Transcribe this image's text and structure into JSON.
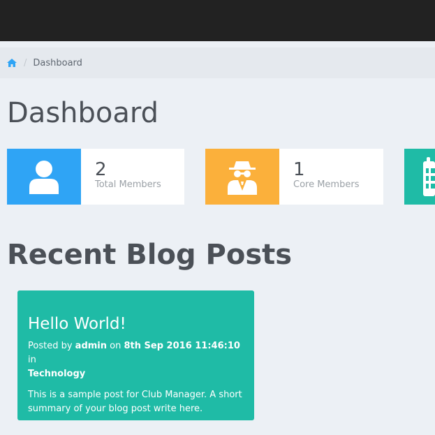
{
  "breadcrumb": {
    "home_icon": "home-icon",
    "current": "Dashboard"
  },
  "page_title": "Dashboard",
  "stats": [
    {
      "value": "2",
      "label": "Total Members",
      "color": "#2fa4f5",
      "icon": "user-icon"
    },
    {
      "value": "1",
      "label": "Core Members",
      "color": "#fbb03b",
      "icon": "spy-icon"
    },
    {
      "value": "",
      "label": "",
      "color": "#1fbba6",
      "icon": "calendar-icon"
    }
  ],
  "recent_section_title": "Recent Blog Posts",
  "post": {
    "title": "Hello World!",
    "posted_by_prefix": "Posted by",
    "author": "admin",
    "on_word": "on",
    "date": "8th Sep 2016 11:46:10",
    "in_word": "in",
    "category": "Technology",
    "summary": "This is a sample post for Club Manager. A short summary of your blog post write here."
  },
  "colors": {
    "topbar": "#222222",
    "background": "#ecf0f5",
    "post_bg": "#1fbba6"
  }
}
